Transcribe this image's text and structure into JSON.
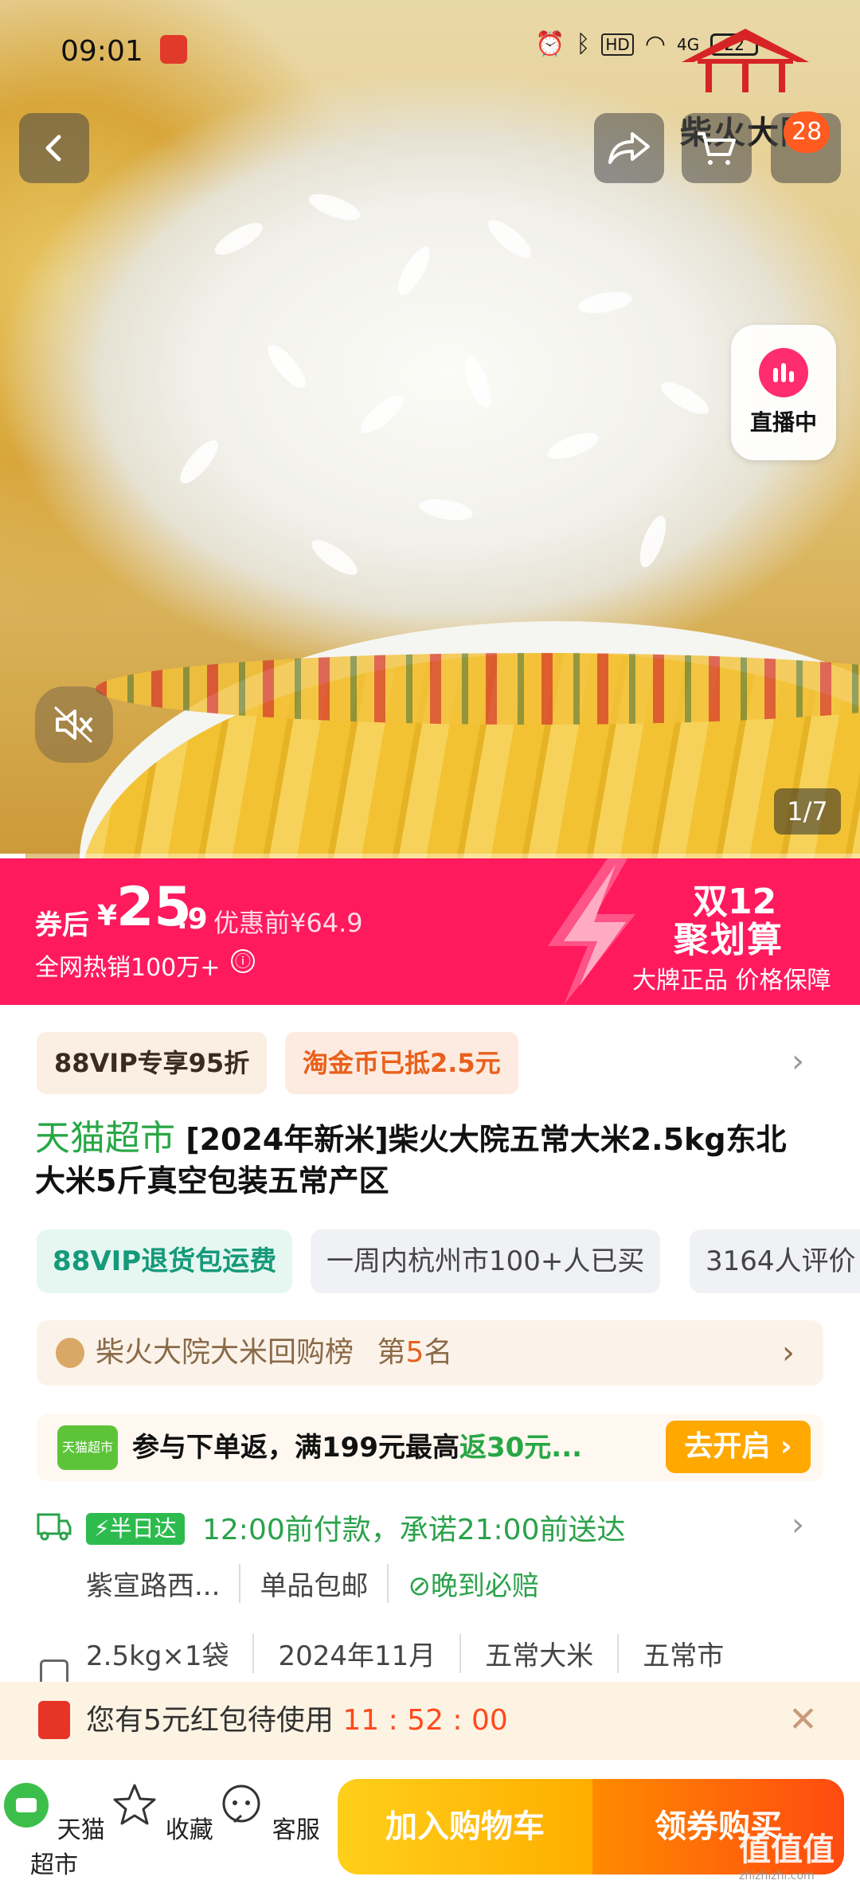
{
  "status_bar": {
    "time": "09:01",
    "network": "4G",
    "battery": "22"
  },
  "brand_logo_text": "柴火大院",
  "header": {
    "cart_count": "28"
  },
  "live": {
    "label": "直播中"
  },
  "gallery": {
    "counter": "1/7",
    "progress": 0.03
  },
  "price_banner": {
    "after_label": "券后",
    "currency": "¥",
    "price_int": "25",
    "price_dec": ".9",
    "original": "优惠前¥64.9",
    "sales": "全网热销100万+",
    "info_icon": "ⓘ",
    "event_title": "双12",
    "event_sub": "聚划算",
    "event_tag": "大牌正品 价格保障"
  },
  "benefits": {
    "vip": "88VIP专享95折",
    "coin": "淘金币已抵2.5元"
  },
  "product": {
    "store": "天猫超市",
    "title": "[2024年新米]柴火大院五常大米2.5kg东北大米5斤真空包装五常产区"
  },
  "tags": [
    "88VIP退货包运费",
    "一周内杭州市100+人已买",
    "3164人评价"
  ],
  "rank": {
    "prefix": "柴火大院大米回购榜",
    "label": "第",
    "num": "5",
    "suffix": "名"
  },
  "promo": {
    "logo_text": "天猫超市",
    "text": "参与下单返，满199元最高",
    "highlight": "返30元...",
    "button": "去开启 ›"
  },
  "shipping": {
    "badge": "⚡半日达",
    "main": "12:00前付款，承诺21:00前送达",
    "address": "紫宣路西...",
    "free": "单品包邮",
    "guarantee": "⊘晚到必赔"
  },
  "specs": [
    "2.5kg×1袋",
    "2024年11月",
    "五常大米",
    "五常市"
  ],
  "red_packet": {
    "text": "您有5元红包待使用",
    "timer": "11 : 52 : 00"
  },
  "bottom": {
    "store": "天猫超市",
    "fav": "收藏",
    "service": "客服",
    "add_cart": "加入购物车",
    "buy": "领券购买"
  },
  "watermark": {
    "main": "值值值",
    "sub": "zhizhizhi.com"
  },
  "colors": {
    "price_banner": "#ff1a5e",
    "tmall_green": "#28a745",
    "cart_btn": "#ffb800",
    "buy_btn": "#ff5a10"
  }
}
